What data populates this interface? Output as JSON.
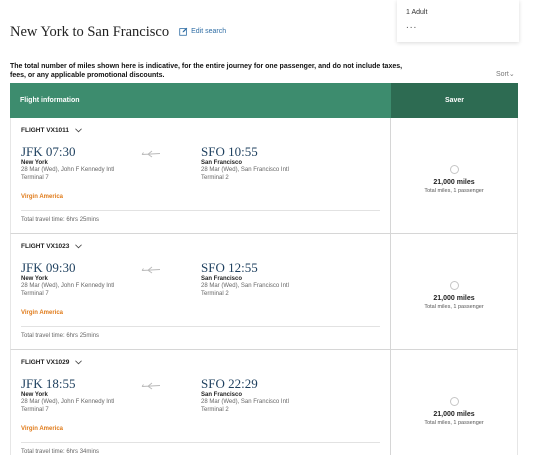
{
  "passengers": {
    "label": "1 Adult",
    "more": "..."
  },
  "header": {
    "title": "New York to San Francisco",
    "edit_label": "Edit search"
  },
  "notice": "The total number of miles shown here is indicative, for the entire journey for one passenger, and do not include taxes, fees, or any applicable promotional discounts.",
  "sort_label": "Sort",
  "table": {
    "col_info": "Flight information",
    "col_saver": "Saver"
  },
  "flights": [
    {
      "number": "FLIGHT VX1011",
      "dep_time": "JFK 07:30",
      "dep_city": "New York",
      "dep_date": "28 Mar (Wed), John F Kennedy Intl",
      "dep_terminal": "Terminal 7",
      "arr_time": "SFO 10:55",
      "arr_city": "San Francisco",
      "arr_date": "28 Mar (Wed), San Francisco Intl",
      "arr_terminal": "Terminal 2",
      "airline": "Virgin America",
      "travel_time": "Total travel time: 6hrs 25mins",
      "miles": "21,000 miles",
      "miles_sub": "Total miles, 1 passenger"
    },
    {
      "number": "FLIGHT VX1023",
      "dep_time": "JFK 09:30",
      "dep_city": "New York",
      "dep_date": "28 Mar (Wed), John F Kennedy Intl",
      "dep_terminal": "Terminal 7",
      "arr_time": "SFO 12:55",
      "arr_city": "San Francisco",
      "arr_date": "28 Mar (Wed), San Francisco Intl",
      "arr_terminal": "Terminal 2",
      "airline": "Virgin America",
      "travel_time": "Total travel time: 6hrs 25mins",
      "miles": "21,000 miles",
      "miles_sub": "Total miles, 1 passenger"
    },
    {
      "number": "FLIGHT VX1029",
      "dep_time": "JFK 18:55",
      "dep_city": "New York",
      "dep_date": "28 Mar (Wed), John F Kennedy Intl",
      "dep_terminal": "Terminal 7",
      "arr_time": "SFO 22:29",
      "arr_city": "San Francisco",
      "arr_date": "28 Mar (Wed), San Francisco Intl",
      "arr_terminal": "Terminal 2",
      "airline": "Virgin America",
      "travel_time": "Total travel time: 6hrs 34mins",
      "miles": "21,000 miles",
      "miles_sub": "Total miles, 1 passenger"
    }
  ],
  "colors": {
    "header_info": "#3d8c6e",
    "header_saver": "#2d6b52",
    "airline": "#e07b1a",
    "time": "#1d3f5e"
  }
}
